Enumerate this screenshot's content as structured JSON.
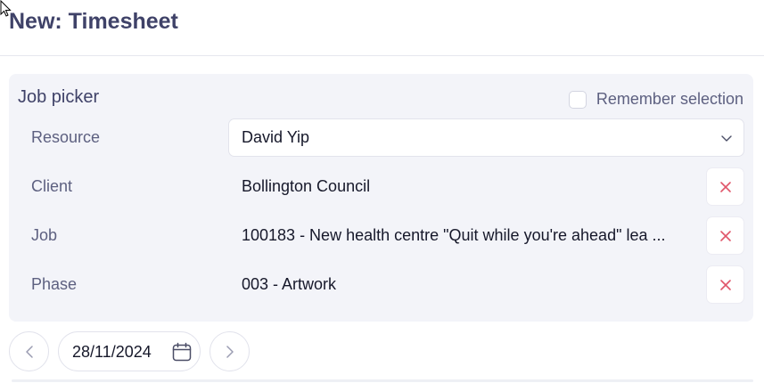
{
  "page": {
    "title": "New: Timesheet"
  },
  "job_picker": {
    "title": "Job picker",
    "remember_selection": {
      "label": "Remember selection",
      "checked": false
    },
    "fields": {
      "resource": {
        "label": "Resource",
        "value": "David Yip",
        "icon": "chevron-down-icon"
      },
      "client": {
        "label": "Client",
        "value": "Bollington Council",
        "icon": "close-icon"
      },
      "job": {
        "label": "Job",
        "value": "100183 - New health centre \"Quit while you're ahead\" lea ...",
        "icon": "close-icon"
      },
      "phase": {
        "label": "Phase",
        "value": "003 - Artwork",
        "icon": "close-icon"
      }
    }
  },
  "date_nav": {
    "date": "28/11/2024",
    "prev_icon": "chevron-left-icon",
    "next_icon": "chevron-right-icon",
    "calendar_icon": "calendar-icon"
  },
  "colors": {
    "accent_clear": "#e0566a",
    "card_bg": "#f3f4f9",
    "title_text": "#3f4268",
    "label_text": "#5d6080"
  }
}
